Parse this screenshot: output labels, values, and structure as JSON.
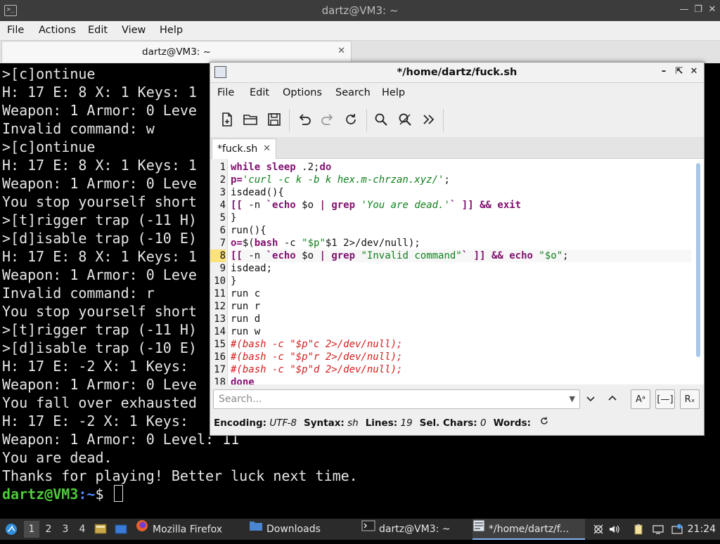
{
  "terminal": {
    "window_title": "dartz@VM3: ~",
    "menu": [
      "File",
      "Actions",
      "Edit",
      "View",
      "Help"
    ],
    "tab_title": "dartz@VM3: ~",
    "lines": [
      ">[c]ontinue",
      "H: 17 E: 8 X: 1 Keys: 1",
      "Weapon: 1 Armor: 0 Leve",
      "Invalid command: w",
      ">[c]ontinue",
      "H: 17 E: 8 X: 1 Keys: 1",
      "Weapon: 1 Armor: 0 Leve",
      "You stop yourself short",
      ">[t]rigger trap (-11 H)",
      ">[d]isable trap (-10 E)",
      "H: 17 E: 8 X: 1 Keys: 1",
      "Weapon: 1 Armor: 0 Leve",
      "Invalid command: r",
      "You stop yourself short",
      ">[t]rigger trap (-11 H)",
      ">[d]isable trap (-10 E)",
      "H: 17 E: -2 X: 1 Keys:",
      "Weapon: 1 Armor: 0 Leve",
      "You fall over exhausted",
      "H: 17 E: -2 X: 1 Keys:",
      "Weapon: 1 Armor: 0 Level: 11",
      "You are dead.",
      "Thanks for playing! Better luck next time."
    ],
    "prompt_user": "dartz@VM3",
    "prompt_sep": ":",
    "prompt_path": "~",
    "prompt_symbol": "$"
  },
  "editor": {
    "window_title": "*/home/dartz/fuck.sh",
    "menu": [
      "File",
      "Edit",
      "Options",
      "Search",
      "Help"
    ],
    "tab_title": "*fuck.sh",
    "current_line": 8,
    "line_numbers": [
      "1",
      "2",
      "3",
      "4",
      "5",
      "6",
      "7",
      "8",
      "9",
      "10",
      "11",
      "12",
      "13",
      "14",
      "15",
      "16",
      "17",
      "18"
    ],
    "code": [
      [
        [
          "k",
          "while"
        ],
        [
          "v",
          " "
        ],
        [
          "p",
          "sleep"
        ],
        [
          "v",
          " .2;"
        ],
        [
          "k",
          "do"
        ]
      ],
      [
        [
          "p",
          "p="
        ],
        [
          "g",
          "'curl -c k -b k hex.m-chrzan.xyz/'"
        ],
        [
          "v",
          ";"
        ]
      ],
      [
        [
          "v",
          "isdead(){"
        ]
      ],
      [
        [
          "p",
          "[["
        ],
        [
          "v",
          " -n "
        ],
        [
          "p",
          "`"
        ],
        [
          "k",
          "echo"
        ],
        [
          "v",
          " $o "
        ],
        [
          "p",
          "|"
        ],
        [
          "v",
          " "
        ],
        [
          "p",
          "grep"
        ],
        [
          "v",
          " "
        ],
        [
          "g",
          "'You are dead.'"
        ],
        [
          "p",
          "`"
        ],
        [
          "v",
          " "
        ],
        [
          "p",
          "]]"
        ],
        [
          "v",
          " "
        ],
        [
          "p",
          "&&"
        ],
        [
          "v",
          " "
        ],
        [
          "k",
          "exit"
        ]
      ],
      [
        [
          "v",
          "}"
        ]
      ],
      [
        [
          "v",
          "run(){"
        ]
      ],
      [
        [
          "p",
          "o="
        ],
        [
          "v",
          "$("
        ],
        [
          "p",
          "bash"
        ],
        [
          "v",
          " -c "
        ],
        [
          "s",
          "\"$p\""
        ],
        [
          "v",
          "$1 2>/dev/null);"
        ]
      ],
      [
        [
          "p",
          "[["
        ],
        [
          "v",
          " -n "
        ],
        [
          "p",
          "`"
        ],
        [
          "k",
          "echo"
        ],
        [
          "v",
          " $o "
        ],
        [
          "p",
          "|"
        ],
        [
          "v",
          " "
        ],
        [
          "p",
          "grep"
        ],
        [
          "v",
          " "
        ],
        [
          "s",
          "\"Invalid command\""
        ],
        [
          "p",
          "`"
        ],
        [
          "v",
          " "
        ],
        [
          "p",
          "]]"
        ],
        [
          "v",
          " "
        ],
        [
          "p",
          "&&"
        ],
        [
          "v",
          " "
        ],
        [
          "k",
          "echo"
        ],
        [
          "v",
          " "
        ],
        [
          "s",
          "\"$o\""
        ],
        [
          "v",
          ";"
        ]
      ],
      [
        [
          "v",
          "isdead;"
        ]
      ],
      [
        [
          "v",
          "}"
        ]
      ],
      [
        [
          "v",
          "run c"
        ]
      ],
      [
        [
          "v",
          "run r"
        ]
      ],
      [
        [
          "v",
          "run d"
        ]
      ],
      [
        [
          "v",
          "run w"
        ]
      ],
      [
        [
          "c",
          "#(bash -c \"$p\"c 2>/dev/null);"
        ]
      ],
      [
        [
          "c",
          "#(bash -c \"$p\"r 2>/dev/null);"
        ]
      ],
      [
        [
          "c",
          "#(bash -c \"$p\"d 2>/dev/null);"
        ]
      ],
      [
        [
          "k",
          "done"
        ]
      ]
    ],
    "search_placeholder": "Search...",
    "status": {
      "encoding_label": "Encoding:",
      "encoding": "UTF-8",
      "syntax_label": "Syntax:",
      "syntax": "sh",
      "lines_label": "Lines:",
      "lines": "19",
      "selchars_label": "Sel. Chars:",
      "selchars": "0",
      "words_label": "Words:"
    }
  },
  "taskbar": {
    "workspaces": [
      "1",
      "2",
      "3",
      "4"
    ],
    "active_workspace": "1",
    "tasks": [
      {
        "label": "Mozilla Firefox",
        "icon": "firefox-icon"
      },
      {
        "label": "Downloads",
        "icon": "folder-icon"
      },
      {
        "label": "dartz@VM3: ~",
        "icon": "terminal-icon"
      },
      {
        "label": "*/home/dartz/f...",
        "icon": "text-editor-icon"
      }
    ],
    "clock": "21:24"
  },
  "colors": {
    "keyword": "#7f0f6e",
    "string": "#117f1c",
    "comment": "#d41c1c",
    "prompt_user": "#4ecb3a",
    "prompt_path": "#4f8cff"
  }
}
